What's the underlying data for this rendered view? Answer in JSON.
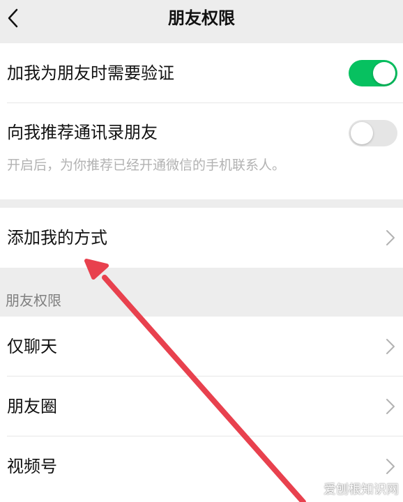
{
  "nav": {
    "title": "朋友权限"
  },
  "verification": {
    "label": "加我为朋友时需要验证",
    "enabled": true
  },
  "recommend_contacts": {
    "label": "向我推荐通讯录朋友",
    "description": "开启后，为你推荐已经开通微信的手机联系人。",
    "enabled": false
  },
  "add_methods": {
    "label": "添加我的方式"
  },
  "friend_permissions": {
    "section_label": "朋友权限",
    "items": [
      {
        "label": "仅聊天"
      },
      {
        "label": "朋友圈"
      },
      {
        "label": "视频号"
      }
    ]
  },
  "colors": {
    "toggle_on": "#07c160",
    "toggle_off": "#e5e5e5",
    "annotation_arrow": "#e8414e"
  },
  "watermark": {
    "text": "爱刨根知识网"
  }
}
